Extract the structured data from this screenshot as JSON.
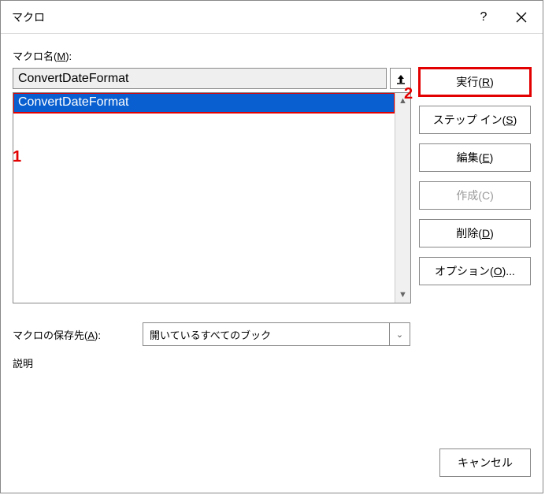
{
  "title": "マクロ",
  "macroNameLabelPre": "マクロ名(",
  "macroNameKey": "M",
  "macroNameLabelPost": "):",
  "macroNameValue": "ConvertDateFormat",
  "listItems": [
    "ConvertDateFormat"
  ],
  "buttons": {
    "run": {
      "pre": "実行(",
      "key": "R",
      "post": ")"
    },
    "stepin": {
      "pre": "ステップ イン(",
      "key": "S",
      "post": ")"
    },
    "edit": {
      "pre": "編集(",
      "key": "E",
      "post": ")"
    },
    "create": {
      "pre": "作成(",
      "key": "C",
      "post": ")"
    },
    "delete": {
      "pre": "削除(",
      "key": "D",
      "post": ")"
    },
    "options": {
      "pre": "オプション(",
      "key": "O",
      "post": ")..."
    }
  },
  "storageLabelPre": "マクロの保存先(",
  "storageKey": "A",
  "storageLabelPost": "):",
  "storageValue": "開いているすべてのブック",
  "descriptionLabel": "説明",
  "cancel": "キャンセル",
  "annotations": {
    "one": "1",
    "two": "2"
  }
}
